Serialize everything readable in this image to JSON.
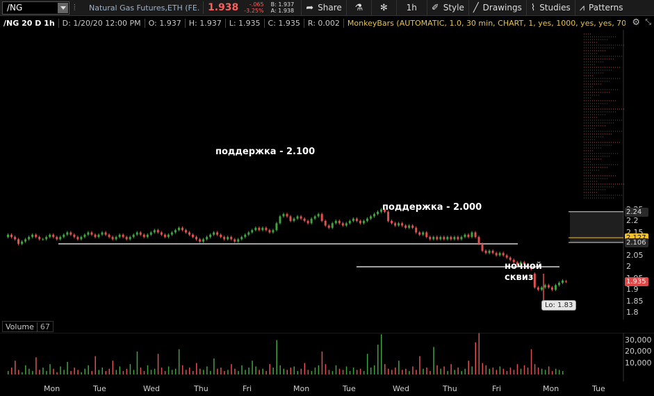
{
  "toolbar": {
    "symbol": "/NG",
    "description": "Natural Gas Futures,ETH (FE...",
    "last_price": "1.938",
    "change": "-.065",
    "change_pct": "-3.25%",
    "bid": "B: 1.937",
    "ask": "A: 1.938",
    "share": "Share",
    "interval": "1h",
    "style": "Style",
    "drawings": "Drawings",
    "studies": "Studies",
    "patterns": "Patterns"
  },
  "infobar": {
    "symbol": "/NG 20 D 1h",
    "date": "D: 1/20/20 12:00 PM",
    "open": "O: 1.937",
    "high": "H: 1.937",
    "low": "L: 1.935",
    "close": "C: 1.935",
    "range": "R: 0.002",
    "study": "MonkeyBars (AUTOMATIC, 1.0, 30 min, CHART, 1, yes, 1000, yes, yes, 70, 100, no, yes,..."
  },
  "price_axis": {
    "ticks": [
      "2.25",
      "2.2",
      "2.15",
      "2.1",
      "2.05",
      "2",
      "1.95",
      "1.9",
      "1.85",
      "1.8"
    ],
    "tags": [
      {
        "text": "2.24",
        "color": "#dddddd",
        "bg": "#2a2a2a"
      },
      {
        "text": "2.127",
        "color": "#111111",
        "bg": "#f2c12e"
      },
      {
        "text": "2.106",
        "color": "#dddddd",
        "bg": "#2a2a2a"
      },
      {
        "text": "1.935",
        "color": "#ffffff",
        "bg": "#e04848"
      }
    ]
  },
  "annotations": {
    "support1": "поддержка - 2.100",
    "support2": "поддержка - 2.000",
    "squeeze_line1": "ночной",
    "squeeze_line2": "сквиз",
    "low_label": "Lo: 1.83"
  },
  "volume": {
    "label": "Volume",
    "count": "67",
    "ticks": [
      "30,000",
      "20,000",
      "10,000"
    ]
  },
  "time_axis": [
    "Mon",
    "Tue",
    "Wed",
    "Thu",
    "Fri",
    "Mon",
    "Tue",
    "Wed",
    "Thu",
    "Fri",
    "Mon",
    "Tue"
  ],
  "colors": {
    "up": "#3fa33f",
    "down": "#e05050",
    "bg": "#000000",
    "accent": "#f2c12e"
  },
  "chart_data": {
    "type": "candlestick",
    "y_range": [
      1.8,
      2.27
    ],
    "support_levels": [
      2.1,
      2.0
    ],
    "close": [
      2.14,
      2.13,
      2.12,
      2.1,
      2.11,
      2.12,
      2.13,
      2.14,
      2.13,
      2.12,
      2.12,
      2.13,
      2.14,
      2.13,
      2.12,
      2.13,
      2.14,
      2.15,
      2.14,
      2.13,
      2.12,
      2.13,
      2.14,
      2.15,
      2.14,
      2.13,
      2.14,
      2.15,
      2.14,
      2.13,
      2.12,
      2.13,
      2.14,
      2.13,
      2.12,
      2.13,
      2.14,
      2.15,
      2.14,
      2.13,
      2.14,
      2.15,
      2.16,
      2.15,
      2.14,
      2.13,
      2.14,
      2.15,
      2.16,
      2.17,
      2.16,
      2.15,
      2.14,
      2.13,
      2.12,
      2.11,
      2.12,
      2.13,
      2.14,
      2.15,
      2.14,
      2.13,
      2.12,
      2.13,
      2.12,
      2.11,
      2.12,
      2.13,
      2.14,
      2.15,
      2.16,
      2.17,
      2.16,
      2.17,
      2.16,
      2.15,
      2.16,
      2.19,
      2.22,
      2.23,
      2.22,
      2.2,
      2.21,
      2.22,
      2.21,
      2.2,
      2.19,
      2.21,
      2.22,
      2.23,
      2.2,
      2.18,
      2.17,
      2.19,
      2.2,
      2.19,
      2.18,
      2.19,
      2.2,
      2.21,
      2.2,
      2.19,
      2.2,
      2.21,
      2.22,
      2.23,
      2.24,
      2.25,
      2.24,
      2.2,
      2.19,
      2.18,
      2.19,
      2.18,
      2.17,
      2.18,
      2.17,
      2.15,
      2.14,
      2.15,
      2.13,
      2.12,
      2.13,
      2.12,
      2.13,
      2.12,
      2.13,
      2.12,
      2.13,
      2.12,
      2.13,
      2.14,
      2.13,
      2.15,
      2.13,
      2.1,
      2.07,
      2.06,
      2.07,
      2.06,
      2.05,
      2.06,
      2.05,
      2.04,
      2.03,
      2.02,
      2.01,
      2.02,
      2.01,
      2.0,
      1.99,
      1.91,
      1.9,
      1.91,
      1.92,
      1.91,
      1.9,
      1.92,
      1.93,
      1.94,
      1.935
    ],
    "open": [
      2.13,
      2.14,
      2.13,
      2.12,
      2.1,
      2.11,
      2.12,
      2.13,
      2.14,
      2.13,
      2.12,
      2.12,
      2.13,
      2.14,
      2.13,
      2.12,
      2.13,
      2.14,
      2.15,
      2.14,
      2.13,
      2.12,
      2.13,
      2.14,
      2.15,
      2.14,
      2.13,
      2.14,
      2.15,
      2.14,
      2.13,
      2.12,
      2.13,
      2.14,
      2.13,
      2.12,
      2.13,
      2.14,
      2.15,
      2.14,
      2.13,
      2.14,
      2.15,
      2.16,
      2.15,
      2.14,
      2.13,
      2.14,
      2.15,
      2.16,
      2.17,
      2.16,
      2.15,
      2.14,
      2.13,
      2.12,
      2.11,
      2.12,
      2.13,
      2.14,
      2.15,
      2.14,
      2.13,
      2.12,
      2.13,
      2.12,
      2.11,
      2.12,
      2.13,
      2.14,
      2.15,
      2.16,
      2.17,
      2.16,
      2.17,
      2.16,
      2.15,
      2.16,
      2.19,
      2.22,
      2.23,
      2.22,
      2.2,
      2.21,
      2.22,
      2.21,
      2.2,
      2.19,
      2.21,
      2.22,
      2.23,
      2.2,
      2.18,
      2.17,
      2.19,
      2.2,
      2.19,
      2.18,
      2.19,
      2.2,
      2.21,
      2.2,
      2.19,
      2.2,
      2.21,
      2.22,
      2.23,
      2.24,
      2.25,
      2.24,
      2.2,
      2.19,
      2.18,
      2.19,
      2.18,
      2.17,
      2.18,
      2.17,
      2.15,
      2.14,
      2.15,
      2.13,
      2.12,
      2.13,
      2.12,
      2.13,
      2.12,
      2.13,
      2.12,
      2.13,
      2.12,
      2.13,
      2.14,
      2.13,
      2.15,
      2.13,
      2.1,
      2.07,
      2.06,
      2.07,
      2.06,
      2.05,
      2.06,
      2.05,
      2.04,
      2.03,
      2.02,
      2.01,
      2.02,
      2.01,
      2.0,
      1.97,
      1.91,
      1.9,
      1.91,
      1.92,
      1.91,
      1.9,
      1.92,
      1.93,
      1.937
    ],
    "volume_k": [
      3,
      6,
      12,
      4,
      2,
      8,
      5,
      3,
      15,
      4,
      6,
      3,
      9,
      5,
      2,
      7,
      4,
      11,
      3,
      6,
      4,
      2,
      5,
      8,
      3,
      16,
      4,
      6,
      3,
      5,
      12,
      4,
      7,
      3,
      5,
      9,
      4,
      20,
      6,
      3,
      8,
      4,
      5,
      18,
      6,
      3,
      7,
      4,
      5,
      22,
      8,
      4,
      6,
      3,
      10,
      5,
      4,
      7,
      3,
      14,
      5,
      6,
      3,
      4,
      9,
      5,
      3,
      8,
      4,
      6,
      12,
      7,
      4,
      5,
      3,
      9,
      6,
      30,
      8,
      5,
      4,
      6,
      7,
      3,
      5,
      10,
      4,
      3,
      6,
      8,
      20,
      9,
      4,
      3,
      8,
      5,
      4,
      7,
      3,
      6,
      4,
      5,
      3,
      18,
      6,
      8,
      26,
      35,
      9,
      5,
      4,
      6,
      12,
      4,
      5,
      3,
      7,
      4,
      16,
      5,
      6,
      3,
      24,
      8,
      5,
      7,
      3,
      9,
      4,
      6,
      3,
      5,
      12,
      7,
      28,
      36,
      10,
      8,
      5,
      6,
      4,
      7,
      5,
      3,
      6,
      4,
      9,
      5,
      8,
      6,
      22,
      9,
      6,
      5,
      4,
      7,
      3,
      5,
      4,
      3
    ]
  }
}
